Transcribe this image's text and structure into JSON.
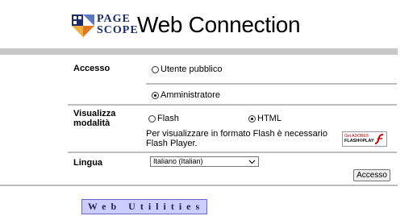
{
  "header": {
    "logo_line1": "PAGE",
    "logo_line2": "SCOPE",
    "app_title": "Web Connection"
  },
  "login": {
    "access_label": "Accesso",
    "access_options": [
      {
        "label": "Utente pubblico",
        "checked": false
      },
      {
        "label": "Amministratore",
        "checked": true
      }
    ],
    "display_label_line1": "Visualizza",
    "display_label_line2": "modalità",
    "display_options": [
      {
        "label": "Flash",
        "checked": false
      },
      {
        "label": "HTML",
        "checked": true
      }
    ],
    "flash_note": "Per visualizzare in formato Flash è necessario Flash Player.",
    "flash_badge": {
      "line1": "Get ADOBE®",
      "line2": "FLASH®PLAYER"
    },
    "language_label": "Lingua",
    "language_selected": "Italiano (Italian)",
    "submit_label": "Accesso"
  },
  "footer": {
    "web_utilities_label": "Web Utilities"
  },
  "colors": {
    "logo_blue": "#1c2c6a",
    "web_utilities_bg": "#ccccff",
    "web_utilities_border": "#6666cc",
    "divider": "#bdbdbd"
  }
}
